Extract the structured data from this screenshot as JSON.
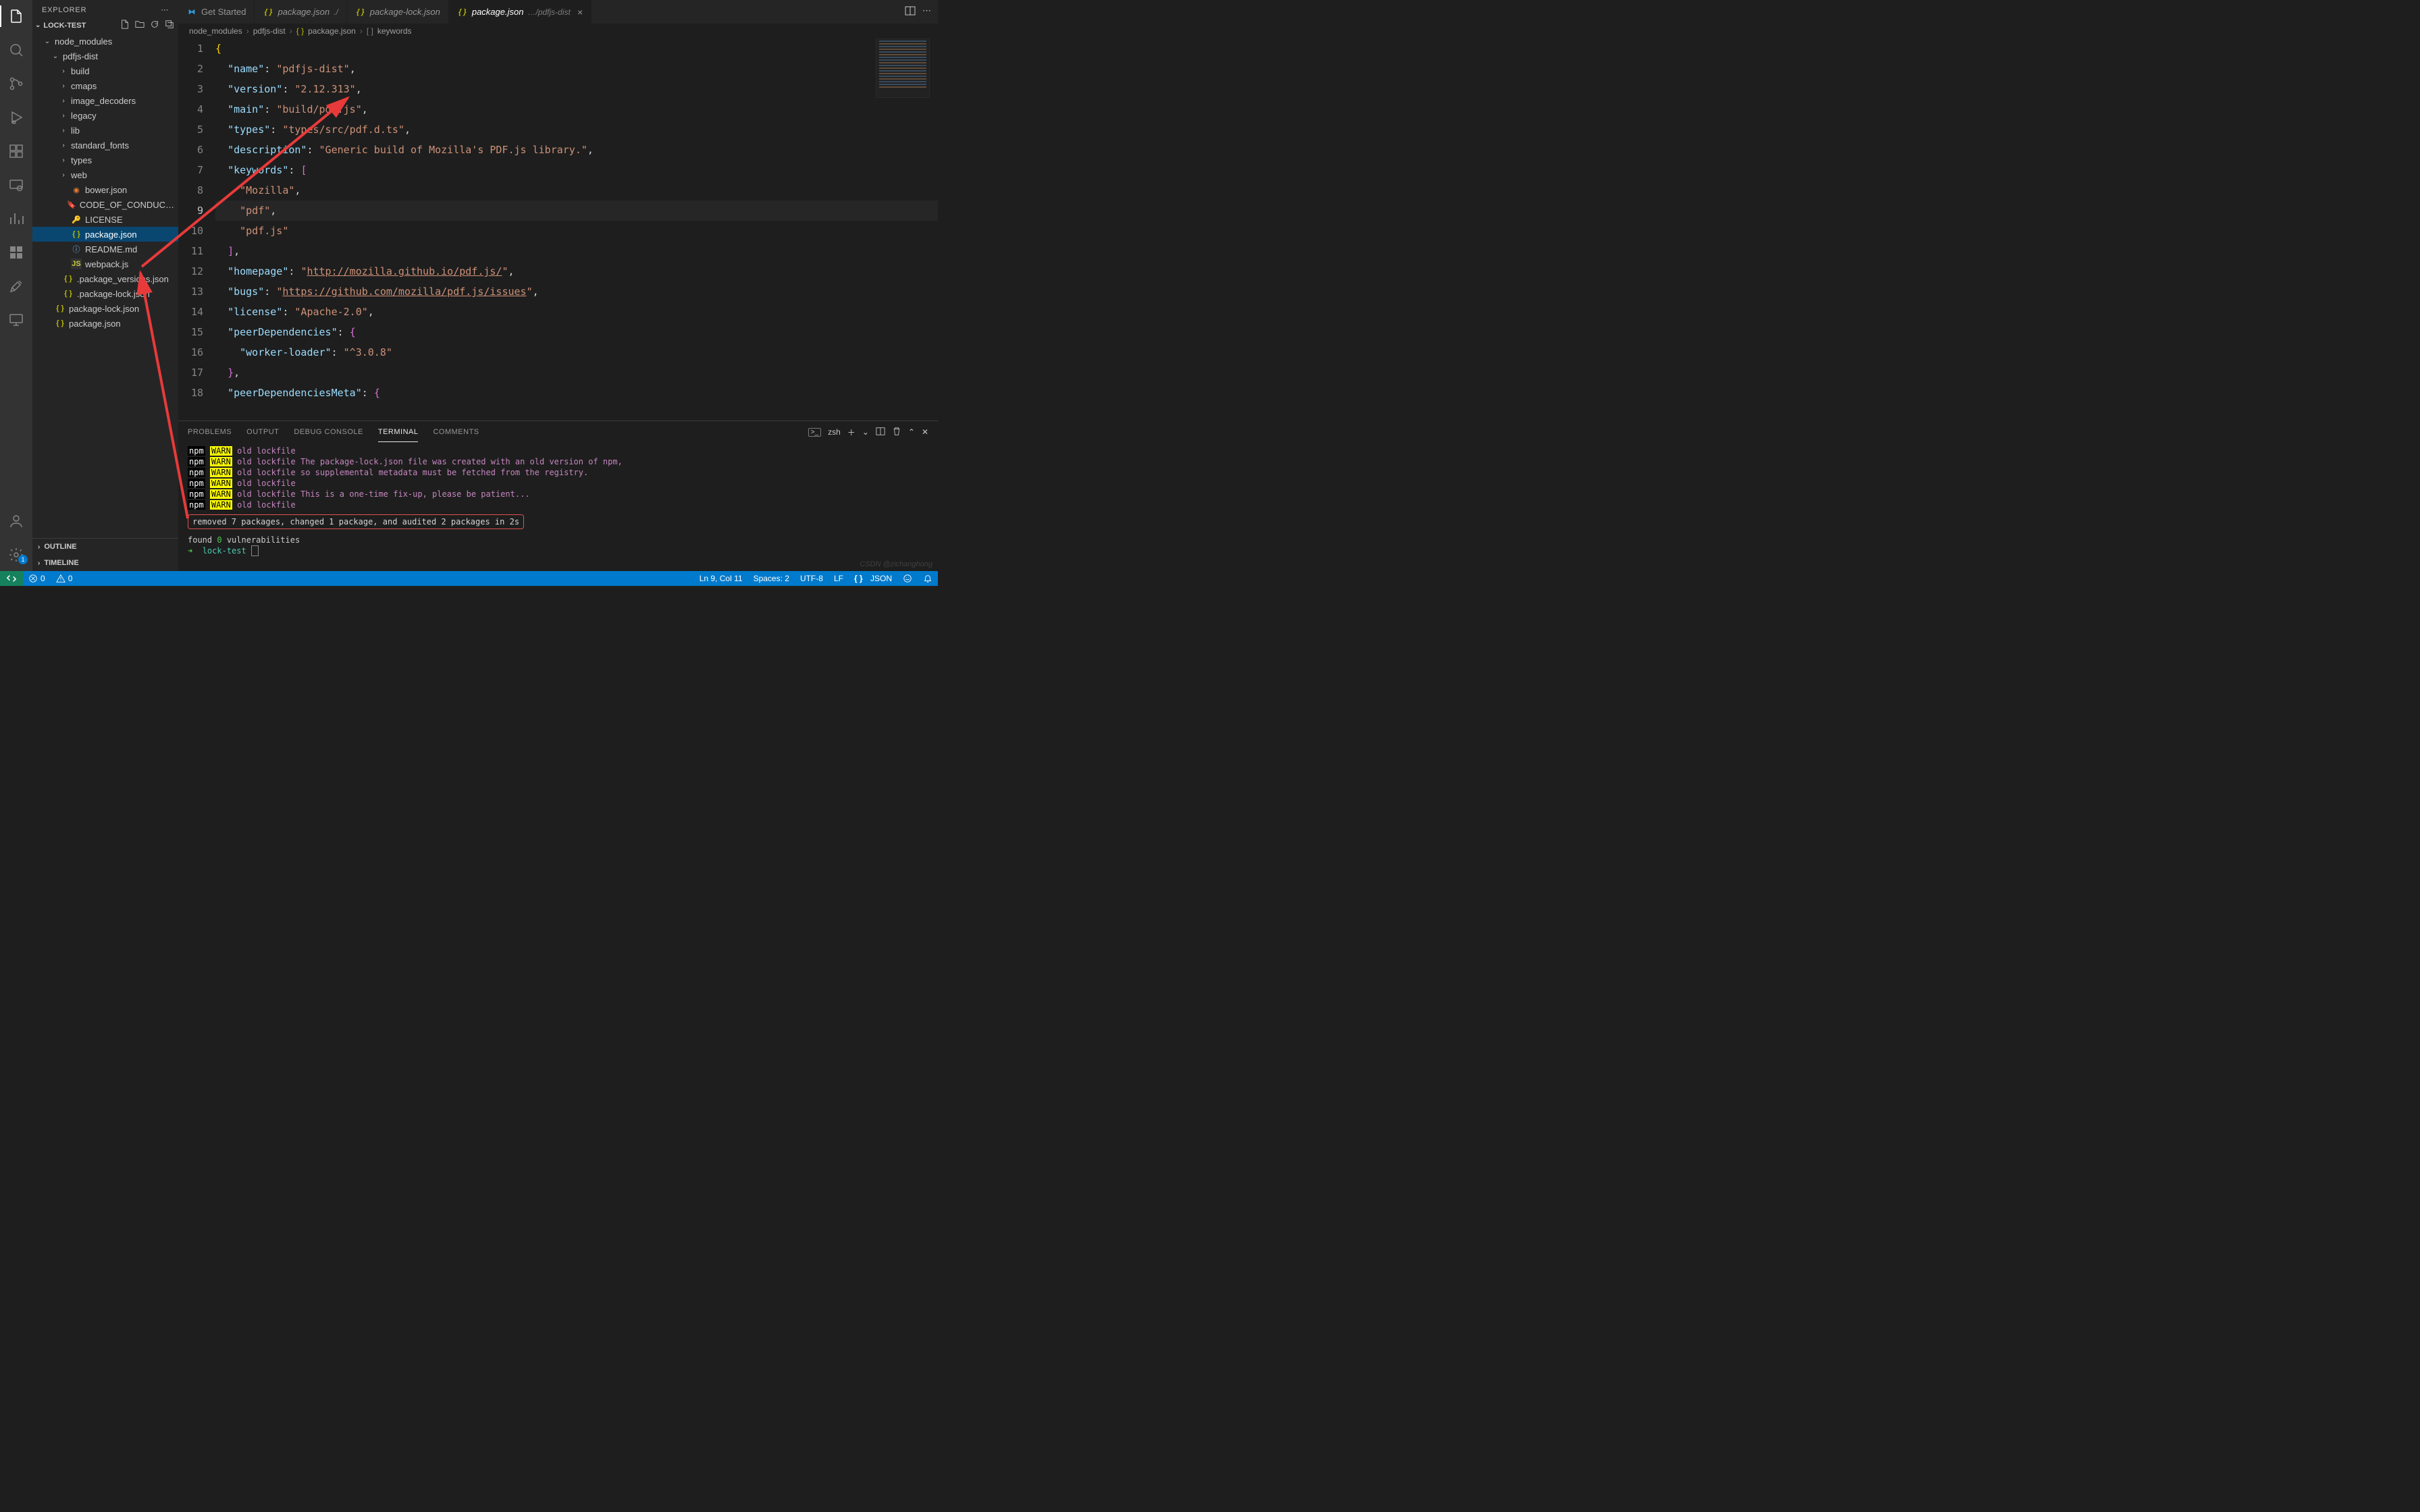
{
  "sidebar": {
    "title": "EXPLORER",
    "project": "LOCK-TEST",
    "outline": "OUTLINE",
    "timeline": "TIMELINE",
    "tree": [
      {
        "type": "folder",
        "name": "node_modules",
        "indent": 1,
        "open": true
      },
      {
        "type": "folder",
        "name": "pdfjs-dist",
        "indent": 2,
        "open": true
      },
      {
        "type": "folder",
        "name": "build",
        "indent": 3,
        "open": false
      },
      {
        "type": "folder",
        "name": "cmaps",
        "indent": 3,
        "open": false
      },
      {
        "type": "folder",
        "name": "image_decoders",
        "indent": 3,
        "open": false
      },
      {
        "type": "folder",
        "name": "legacy",
        "indent": 3,
        "open": false
      },
      {
        "type": "folder",
        "name": "lib",
        "indent": 3,
        "open": false
      },
      {
        "type": "folder",
        "name": "standard_fonts",
        "indent": 3,
        "open": false
      },
      {
        "type": "folder",
        "name": "types",
        "indent": 3,
        "open": false
      },
      {
        "type": "folder",
        "name": "web",
        "indent": 3,
        "open": false
      },
      {
        "type": "file",
        "name": "bower.json",
        "indent": 3,
        "icon": "orange",
        "sym": "🅱"
      },
      {
        "type": "file",
        "name": "CODE_OF_CONDUC…",
        "indent": 3,
        "icon": "blue",
        "sym": "🔖"
      },
      {
        "type": "file",
        "name": "LICENSE",
        "indent": 3,
        "icon": "key",
        "sym": "🔑"
      },
      {
        "type": "file",
        "name": "package.json",
        "indent": 3,
        "icon": "json",
        "sel": true
      },
      {
        "type": "file",
        "name": "README.md",
        "indent": 3,
        "icon": "info",
        "sym": "ⓘ"
      },
      {
        "type": "file",
        "name": "webpack.js",
        "indent": 3,
        "icon": "js"
      },
      {
        "type": "file",
        "name": ".package_versions.json",
        "indent": 2,
        "icon": "json"
      },
      {
        "type": "file",
        "name": ".package-lock.json",
        "indent": 2,
        "icon": "json"
      },
      {
        "type": "file",
        "name": "package-lock.json",
        "indent": 1,
        "icon": "json"
      },
      {
        "type": "file",
        "name": "package.json",
        "indent": 1,
        "icon": "json"
      }
    ]
  },
  "tabs": [
    {
      "label": "Get Started",
      "icon": "vs",
      "first": true
    },
    {
      "label": "package.json",
      "path": "./",
      "icon": "json"
    },
    {
      "label": "package-lock.json",
      "icon": "json"
    },
    {
      "label": "package.json",
      "path": "…/pdfjs-dist",
      "icon": "json",
      "active": true,
      "close": true
    }
  ],
  "breadcrumb": [
    "node_modules",
    "pdfjs-dist",
    "package.json",
    "keywords"
  ],
  "code": {
    "lines_start": 1,
    "current_line": 9
  },
  "panel": {
    "tabs": [
      "PROBLEMS",
      "OUTPUT",
      "DEBUG CONSOLE",
      "TERMINAL",
      "COMMENTS"
    ],
    "active": "TERMINAL",
    "shell": "zsh",
    "npm_lines": [
      "old lockfile",
      "old lockfile The package-lock.json file was created with an old version of npm,",
      "old lockfile so supplemental metadata must be fetched from the registry.",
      "old lockfile",
      "old lockfile This is a one-time fix-up, please be patient...",
      "old lockfile"
    ],
    "result": "removed 7 packages, changed 1 package, and audited 2 packages in 2s",
    "found_pre": "found ",
    "found_n": "0",
    "found_post": " vulnerabilities",
    "prompt_pre": "➜  ",
    "prompt": "lock-test",
    "cursor": "▯"
  },
  "status": {
    "errors": "0",
    "warnings": "0",
    "lncol": "Ln 9, Col 11",
    "spaces": "Spaces: 2",
    "enc": "UTF-8",
    "eol": "LF",
    "lang": "JSON"
  },
  "settings_badge": "1",
  "watermark": "CSDN @zichanghong"
}
